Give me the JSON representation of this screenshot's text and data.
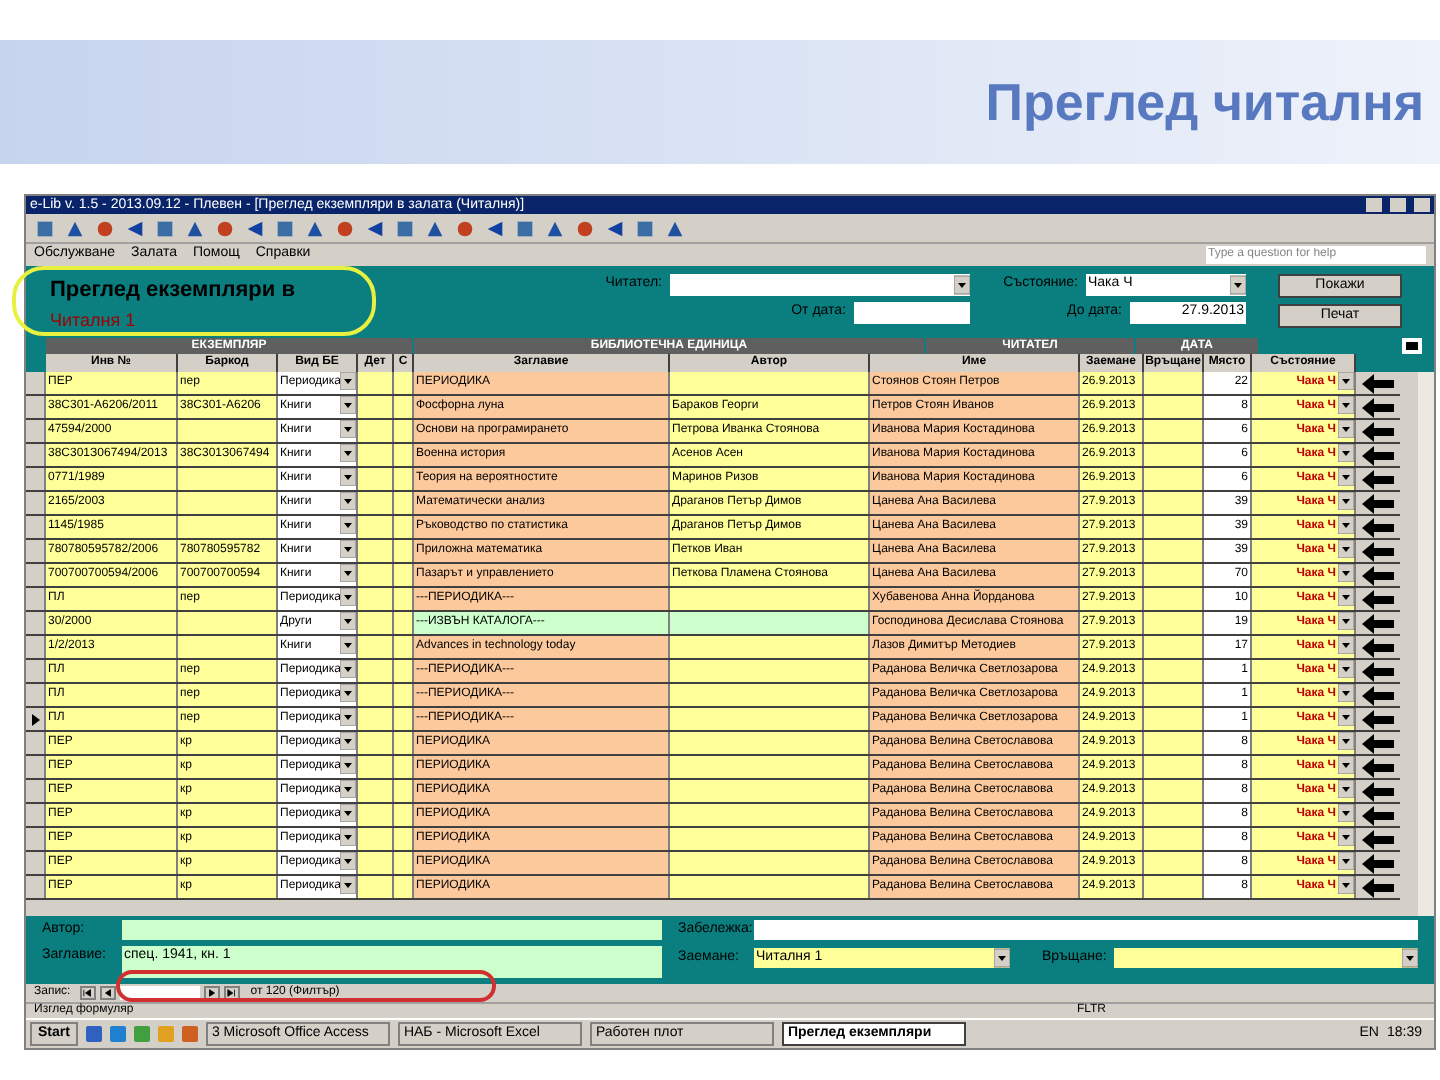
{
  "slide": {
    "title": "Преглед читалня"
  },
  "window": {
    "title": "e-Lib v. 1.5 - 2013.09.12 - Плевен - [Преглед екземпляри в залата (Читалня)]",
    "menu": [
      "Обслужване",
      "Залата",
      "Помощ",
      "Справки"
    ],
    "help_placeholder": "Type a question for help"
  },
  "form": {
    "heading": "Преглед екземпляри в",
    "room": "Читалня 1",
    "reader_label": "Читател:",
    "from_label": "От дата:",
    "to_label": "До дата:",
    "to_value": "27.9.2013",
    "status_label": "Състояние:",
    "status_value": "Чака Ч",
    "buttons": [
      "Покажи",
      "Печат"
    ]
  },
  "table": {
    "groups": [
      "ЕКЗЕМПЛЯР",
      "БИБЛИОТЕЧНА ЕДИНИЦА",
      "ЧИТАТЕЛ",
      "ДАТА"
    ],
    "columns": [
      "Инв №",
      "Баркод",
      "Вид БЕ",
      "Дет",
      "С",
      "Заглавие",
      "Автор",
      "Име",
      "Заемане",
      "Връщане",
      "Място",
      "Състояние"
    ],
    "rows": [
      {
        "inv": "ПЕР",
        "barcode": "пер",
        "type": "Периодика",
        "title": "ПЕРИОДИКА",
        "reader": "Стоянов Стоян Петров",
        "loaned": "26.9.2013",
        "place": "22",
        "status": "Чака Ч",
        "catalog": false,
        "current": false
      },
      {
        "inv": "38С301-А6206/2011",
        "barcode": "38С301-А6206",
        "type": "Книги",
        "title": "Фосфорна луна",
        "author": "Бараков Георги",
        "reader": "Петров Стоян Иванов",
        "loaned": "26.9.2013",
        "place": "8",
        "status": "Чака Ч",
        "catalog": false,
        "current": false
      },
      {
        "inv": "47594/2000",
        "type": "Книги",
        "title": "Основи на програмирането",
        "author": "Петрова Иванка Стоянова",
        "reader": "Иванова Мария Костадинова",
        "loaned": "26.9.2013",
        "place": "6",
        "status": "Чака Ч",
        "catalog": false,
        "current": false
      },
      {
        "inv": "38С301З067494/2013",
        "barcode": "38С301З067494",
        "type": "Книги",
        "title": "Военна история",
        "author": "Асенов Асен",
        "reader": "Иванова Мария Костадинова",
        "loaned": "26.9.2013",
        "place": "6",
        "status": "Чака Ч",
        "catalog": false,
        "current": false
      },
      {
        "inv": "0771/1989",
        "type": "Книги",
        "title": "Теория на вероятностите",
        "author": "Маринов Ризов",
        "reader": "Иванова Мария Костадинова",
        "loaned": "26.9.2013",
        "place": "6",
        "status": "Чака Ч",
        "catalog": false,
        "current": false
      },
      {
        "inv": "2165/2003",
        "type": "Книги",
        "title": "Математически анализ",
        "author": "Драганов Петър Димов",
        "reader": "Цанева Ана Василева",
        "loaned": "27.9.2013",
        "place": "39",
        "status": "Чака Ч",
        "catalog": false,
        "current": false
      },
      {
        "inv": "1145/1985",
        "type": "Книги",
        "title": "Ръководство по статистика",
        "author": "Драганов Петър Димов",
        "reader": "Цанева Ана Василева",
        "loaned": "27.9.2013",
        "place": "39",
        "status": "Чака Ч",
        "catalog": false,
        "current": false
      },
      {
        "inv": "780780595782/2006",
        "barcode": "780780595782",
        "type": "Книги",
        "title": "Приложна математика",
        "author": "Петков Иван",
        "reader": "Цанева Ана Василева",
        "loaned": "27.9.2013",
        "place": "39",
        "status": "Чака Ч",
        "catalog": false,
        "current": false
      },
      {
        "inv": "700700700594/2006",
        "barcode": "700700700594",
        "type": "Книги",
        "title": "Пазарът и управлението",
        "author": "Петкова Пламена Стоянова",
        "reader": "Цанева Ана Василева",
        "loaned": "27.9.2013",
        "place": "70",
        "status": "Чака Ч",
        "catalog": false,
        "current": false
      },
      {
        "inv": "ПЛ",
        "barcode": "пер",
        "type": "Периодика",
        "title": "---ПЕРИОДИКА---",
        "reader": "Хубавенова Анна Йорданова",
        "loaned": "27.9.2013",
        "place": "10",
        "status": "Чака Ч",
        "catalog": false,
        "current": false
      },
      {
        "inv": "30/2000",
        "type": "Други",
        "title": "---ИЗВЪН КАТАЛОГА---",
        "reader": "Господинова Десислава Стоянова",
        "loaned": "27.9.2013",
        "place": "19",
        "status": "Чака Ч",
        "catalog": true,
        "current": false
      },
      {
        "inv": "1/2/2013",
        "type": "Книги",
        "title": "Advances in technology today",
        "reader": "Лазов Димитър Методиев",
        "loaned": "27.9.2013",
        "place": "17",
        "status": "Чака Ч",
        "catalog": false,
        "current": false
      },
      {
        "inv": "ПЛ",
        "barcode": "пер",
        "type": "Периодика",
        "title": "---ПЕРИОДИКА---",
        "reader": "Раданова Величка Светлозарова",
        "loaned": "24.9.2013",
        "place": "1",
        "status": "Чака Ч",
        "catalog": false,
        "current": false
      },
      {
        "inv": "ПЛ",
        "barcode": "пер",
        "type": "Периодика",
        "title": "---ПЕРИОДИКА---",
        "reader": "Раданова Величка Светлозарова",
        "loaned": "24.9.2013",
        "place": "1",
        "status": "Чака Ч",
        "catalog": false,
        "current": false
      },
      {
        "inv": "ПЛ",
        "barcode": "пер",
        "type": "Периодика",
        "title": "---ПЕРИОДИКА---",
        "reader": "Раданова Величка Светлозарова",
        "loaned": "24.9.2013",
        "place": "1",
        "status": "Чака Ч",
        "catalog": false,
        "current": true
      },
      {
        "inv": "ПЕР",
        "barcode": "кр",
        "type": "Периодика",
        "title": "ПЕРИОДИКА",
        "reader": "Раданова Велина Светославова",
        "loaned": "24.9.2013",
        "place": "8",
        "status": "Чака Ч",
        "catalog": false,
        "current": false
      },
      {
        "inv": "ПЕР",
        "barcode": "кр",
        "type": "Периодика",
        "title": "ПЕРИОДИКА",
        "reader": "Раданова Велина Светославова",
        "loaned": "24.9.2013",
        "place": "8",
        "status": "Чака Ч",
        "catalog": false,
        "current": false
      },
      {
        "inv": "ПЕР",
        "barcode": "кр",
        "type": "Периодика",
        "title": "ПЕРИОДИКА",
        "reader": "Раданова Велина Светославова",
        "loaned": "24.9.2013",
        "place": "8",
        "status": "Чака Ч",
        "catalog": false,
        "current": false
      },
      {
        "inv": "ПЕР",
        "barcode": "кр",
        "type": "Периодика",
        "title": "ПЕРИОДИКА",
        "reader": "Раданова Велина Светославова",
        "loaned": "24.9.2013",
        "place": "8",
        "status": "Чака Ч",
        "catalog": false,
        "current": false
      },
      {
        "inv": "ПЕР",
        "barcode": "кр",
        "type": "Периодика",
        "title": "ПЕРИОДИКА",
        "reader": "Раданова Велина Светославова",
        "loaned": "24.9.2013",
        "place": "8",
        "status": "Чака Ч",
        "catalog": false,
        "current": false
      },
      {
        "inv": "ПЕР",
        "barcode": "кр",
        "type": "Периодика",
        "title": "ПЕРИОДИКА",
        "reader": "Раданова Велина Светославова",
        "loaned": "24.9.2013",
        "place": "8",
        "status": "Чака Ч",
        "catalog": false,
        "current": false
      },
      {
        "inv": "ПЕР",
        "barcode": "кр",
        "type": "Периодика",
        "title": "ПЕРИОДИКА",
        "reader": "Раданова Велина Светославова",
        "loaned": "24.9.2013",
        "place": "8",
        "status": "Чака Ч",
        "catalog": false,
        "current": false
      }
    ]
  },
  "details": {
    "author_label": "Автор:",
    "title_label": "Заглавие:",
    "title_value": "спец. 1941, кн. 1",
    "note_label": "Забележка:",
    "loan_label": "Заемане:",
    "loan_value": "Читалня 1",
    "return_label": "Връщане:"
  },
  "navigator": {
    "label": "Запис:",
    "total": "от 120 (Филтър)"
  },
  "status_bar": {
    "text": "Изглед формуляр",
    "indicator": "FLTR"
  },
  "taskbar": {
    "start": "Start",
    "tasks": [
      {
        "label": "3 Microsoft Office Access",
        "selected": false
      },
      {
        "label": "НАБ - Microsoft Excel",
        "selected": false
      },
      {
        "label": "Работен плот",
        "selected": false
      },
      {
        "label": "Преглед екземпляри",
        "selected": true
      }
    ],
    "language": "EN",
    "clock": "18:39"
  }
}
